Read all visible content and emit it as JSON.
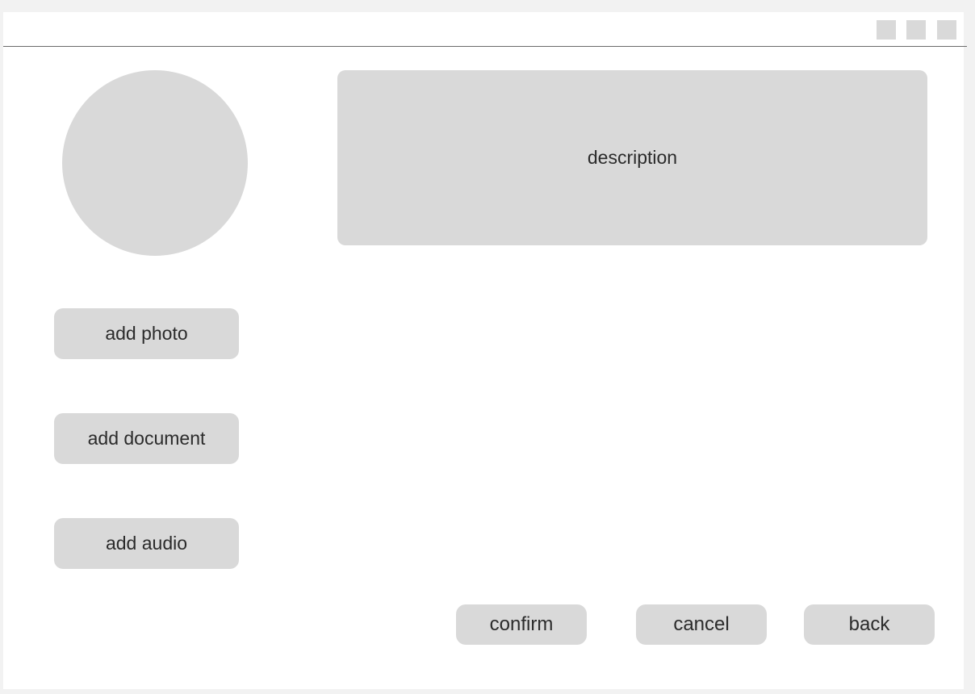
{
  "window": {
    "controls": [
      "minimize-control",
      "maximize-control",
      "close-control"
    ]
  },
  "profile": {
    "avatar": "avatar-placeholder"
  },
  "description": {
    "label": "description"
  },
  "sidebar": {
    "add_photo_label": "add photo",
    "add_document_label": "add document",
    "add_audio_label": "add audio"
  },
  "actions": {
    "confirm_label": "confirm",
    "cancel_label": "cancel",
    "back_label": "back"
  },
  "colors": {
    "page_background": "#f2f2f2",
    "window_background": "#ffffff",
    "placeholder_gray": "#d9d9d9",
    "text": "#2b2b2b",
    "divider": "#6b6b6b"
  }
}
